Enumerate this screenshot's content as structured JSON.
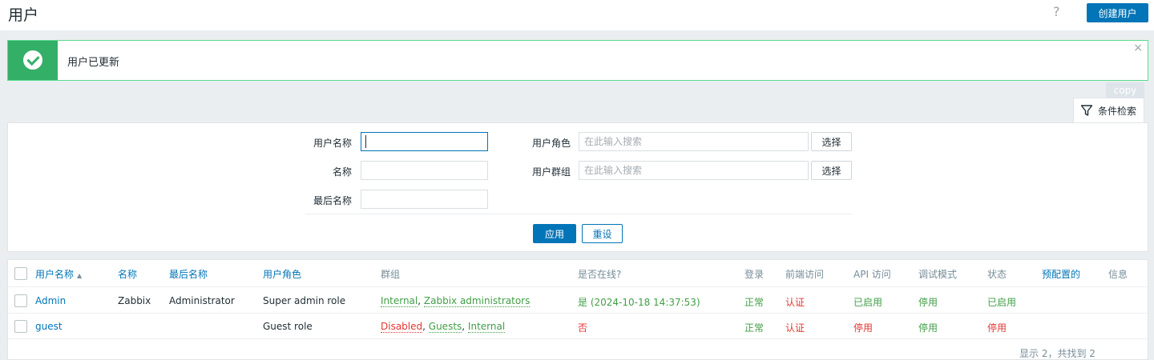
{
  "header": {
    "title": "用户",
    "help_icon": "?",
    "create_button": "创建用户"
  },
  "message": {
    "text": "用户已更新",
    "close": "×"
  },
  "copy_button": "copy",
  "filter_tab": {
    "label": "条件检索",
    "icon": "filter-icon"
  },
  "filter": {
    "username_label": "用户名称",
    "name_label": "名称",
    "lastname_label": "最后名称",
    "role_label": "用户角色",
    "role_placeholder": "在此输入搜索",
    "group_label": "用户群组",
    "group_placeholder": "在此输入搜索",
    "select_label": "选择",
    "apply": "应用",
    "reset": "重设"
  },
  "table": {
    "columns": [
      "用户名称",
      "名称",
      "最后名称",
      "用户角色",
      "群组",
      "是否在线?",
      "登录",
      "前端访问",
      "API 访问",
      "调试模式",
      "状态",
      "预配置的",
      "信息"
    ],
    "sort_indicator": "▲",
    "rows": [
      {
        "username": "Admin",
        "name": "Zabbix",
        "lastname": "Administrator",
        "role": "Super admin role",
        "group_1": "Internal",
        "group_sep_1": ", ",
        "group_2": "Zabbix administrators",
        "online": "是 (2024-10-18 14:37:53)",
        "login": "正常",
        "frontend": "认证",
        "api": "已启用",
        "debug": "停用",
        "status": "已启用"
      },
      {
        "username": "guest",
        "name": "",
        "lastname": "",
        "role": "Guest role",
        "group_1": "Disabled",
        "group_sep_1": ", ",
        "group_2": "Guests",
        "group_sep_2": ", ",
        "group_3": "Internal",
        "online": "否",
        "login": "正常",
        "frontend": "认证",
        "api": "停用",
        "debug": "停用",
        "status": "停用"
      }
    ],
    "footer": "显示 2，共找到 2"
  },
  "colors": {
    "accent": "#0275b8",
    "success": "#34af67",
    "green_text": "#429e47",
    "red_text": "#e33734"
  }
}
